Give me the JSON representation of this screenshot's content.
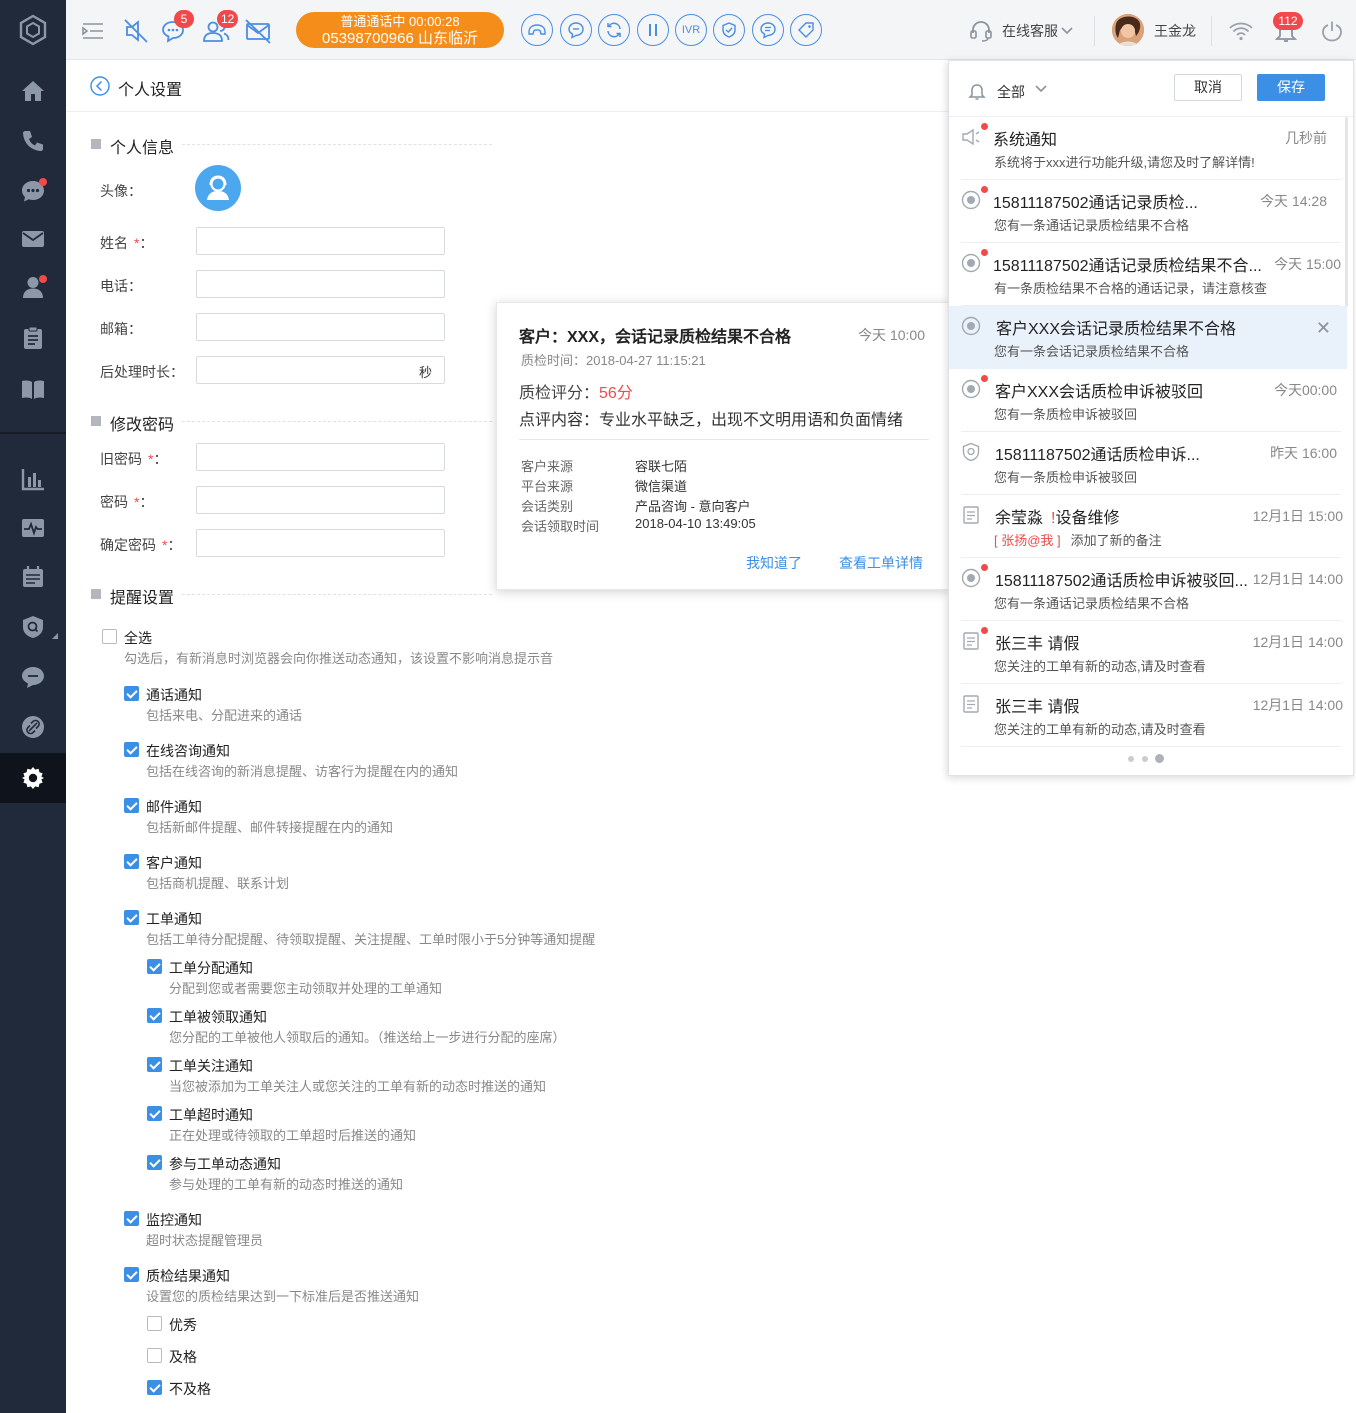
{
  "toolbar": {
    "badges": {
      "chat": "5",
      "contacts": "12",
      "bell": "112"
    },
    "call_status": "普通通话中  00:00:28",
    "call_number": "05398700966 山东临沂",
    "ivr_label": "IVR",
    "service_mode": "在线客服",
    "user_name": "王金龙"
  },
  "page": {
    "title": "个人设置"
  },
  "profile": {
    "section_title": "个人信息",
    "avatar_label": "头像：",
    "name_label": "姓名",
    "phone_label": "电话：",
    "email_label": "邮箱：",
    "after_label": "后处理时长：",
    "after_suffix": "秒"
  },
  "password": {
    "section_title": "修改密码",
    "old_label": "旧密码",
    "new_label": "密码",
    "confirm_label": "确定密码"
  },
  "required_mark": "*",
  "colon": "：",
  "reminder": {
    "section_title": "提醒设置",
    "select_all": "全选",
    "select_all_desc": "勾选后，有新消息时浏览器会向你推送动态通知，该设置不影响消息提示音",
    "items": [
      {
        "label": "通话通知",
        "desc": "包括来电、分配进来的通话"
      },
      {
        "label": "在线咨询通知",
        "desc": "包括在线咨询的新消息提醒、访客行为提醒在内的通知"
      },
      {
        "label": "邮件通知",
        "desc": "包括新邮件提醒、邮件转接提醒在内的通知"
      },
      {
        "label": "客户通知",
        "desc": "包括商机提醒、联系计划"
      },
      {
        "label": "工单通知",
        "desc": "包括工单待分配提醒、待领取提醒、关注提醒、工单时限小于5分钟等通知提醒"
      }
    ],
    "sub_items": [
      {
        "label": "工单分配通知",
        "desc": "分配到您或者需要您主动领取并处理的工单通知"
      },
      {
        "label": "工单被领取通知",
        "desc": "您分配的工单被他人领取后的通知。（推送给上一步进行分配的座席）"
      },
      {
        "label": "工单关注通知",
        "desc": "当您被添加为工单关注人或您关注的工单有新的动态时推送的通知"
      },
      {
        "label": "工单超时通知",
        "desc": "正在处理或待领取的工单超时后推送的通知"
      },
      {
        "label": "参与工单动态通知",
        "desc": "参与处理的工单有新的动态时推送的通知"
      }
    ],
    "monitor": {
      "label": "监控通知",
      "desc": "超时状态提醒管理员"
    },
    "quality": {
      "label": "质检结果通知",
      "desc": "设置您的质检结果达到一下标准后是否推送通知"
    },
    "quality_levels": [
      "优秀",
      "及格",
      "不及格"
    ]
  },
  "popup": {
    "title": "客户：XXX，会话记录质检结果不合格",
    "time": "今天  10:00",
    "check_time": "质检时间：2018-04-27 11:15:21",
    "score_label": "质检评分：",
    "score_value": "56分",
    "comment": "点评内容：专业水平缺乏，出现不文明用语和负面情绪",
    "details": [
      {
        "k": "客户来源",
        "v": "容联七陌"
      },
      {
        "k": "平台来源",
        "v": "微信渠道"
      },
      {
        "k": "会话类别",
        "v": "产品咨询 - 意向客户"
      },
      {
        "k": "会话领取时间",
        "v": "2018-04-10  13:49:05"
      }
    ],
    "ack_link": "我知道了",
    "detail_link": "查看工单详情"
  },
  "notifications": {
    "filter": "全部",
    "cancel": "取消",
    "save": "保存",
    "items": [
      {
        "icon": "speaker-icon",
        "title": "系统通知",
        "time": "几秒前",
        "body": "系统将于xxx进行功能升级,请您及时了解详情!",
        "unread": true
      },
      {
        "icon": "quality-check-icon",
        "title": "15811187502通话记录质检...",
        "time": "今天  14:28",
        "body": "您有一条通话记录质检结果不合格",
        "unread": true
      },
      {
        "icon": "quality-check-icon",
        "title": "15811187502通话记录质检结果不合...",
        "time": "今天 15:00",
        "body": "有一条质检结果不合格的通话记录，请注意核查",
        "unread": true
      },
      {
        "icon": "quality-check-icon",
        "title": "客户XXX会话记录质检结果不合格",
        "time": "",
        "body": "您有一条会话记录质检结果不合格",
        "unread": false
      },
      {
        "icon": "quality-check-icon",
        "title": "客户XXX会话质检申诉被驳回",
        "time": "今天00:00",
        "body": "您有一条质检申诉被驳回",
        "unread": true
      },
      {
        "icon": "shield-icon",
        "title": "15811187502通话质检申诉...",
        "time": "昨天  16:00",
        "body": "您有一条质检申诉被驳回",
        "unread": false
      },
      {
        "icon": "ticket-icon",
        "title": "余莹淼",
        "time": "12月1日 15:00",
        "body": "添加了新的备注",
        "unread": false
      },
      {
        "icon": "quality-check-icon",
        "title": "15811187502通话质检申诉被驳回...",
        "time": "12月1日 14:00",
        "body": "您有一条通话记录质检结果不合格",
        "unread": true
      },
      {
        "icon": "ticket-icon",
        "title": "张三丰  请假",
        "time": "12月1日 14:00",
        "body": "您关注的工单有新的动态,请及时查看",
        "unread": true
      },
      {
        "icon": "ticket-icon",
        "title": "张三丰  请假",
        "time": "12月1日 14:00",
        "body": "您关注的工单有新的动态,请及时查看",
        "unread": false
      }
    ],
    "ticket_mark": "!",
    "ticket_subject": "设备维修",
    "mention": "[ 张扬@我 ]"
  },
  "colors": {
    "accent": "#3b8fe4",
    "call": "#f48d1a",
    "sidebar": "#212a3a",
    "alert": "#f24a4a"
  }
}
